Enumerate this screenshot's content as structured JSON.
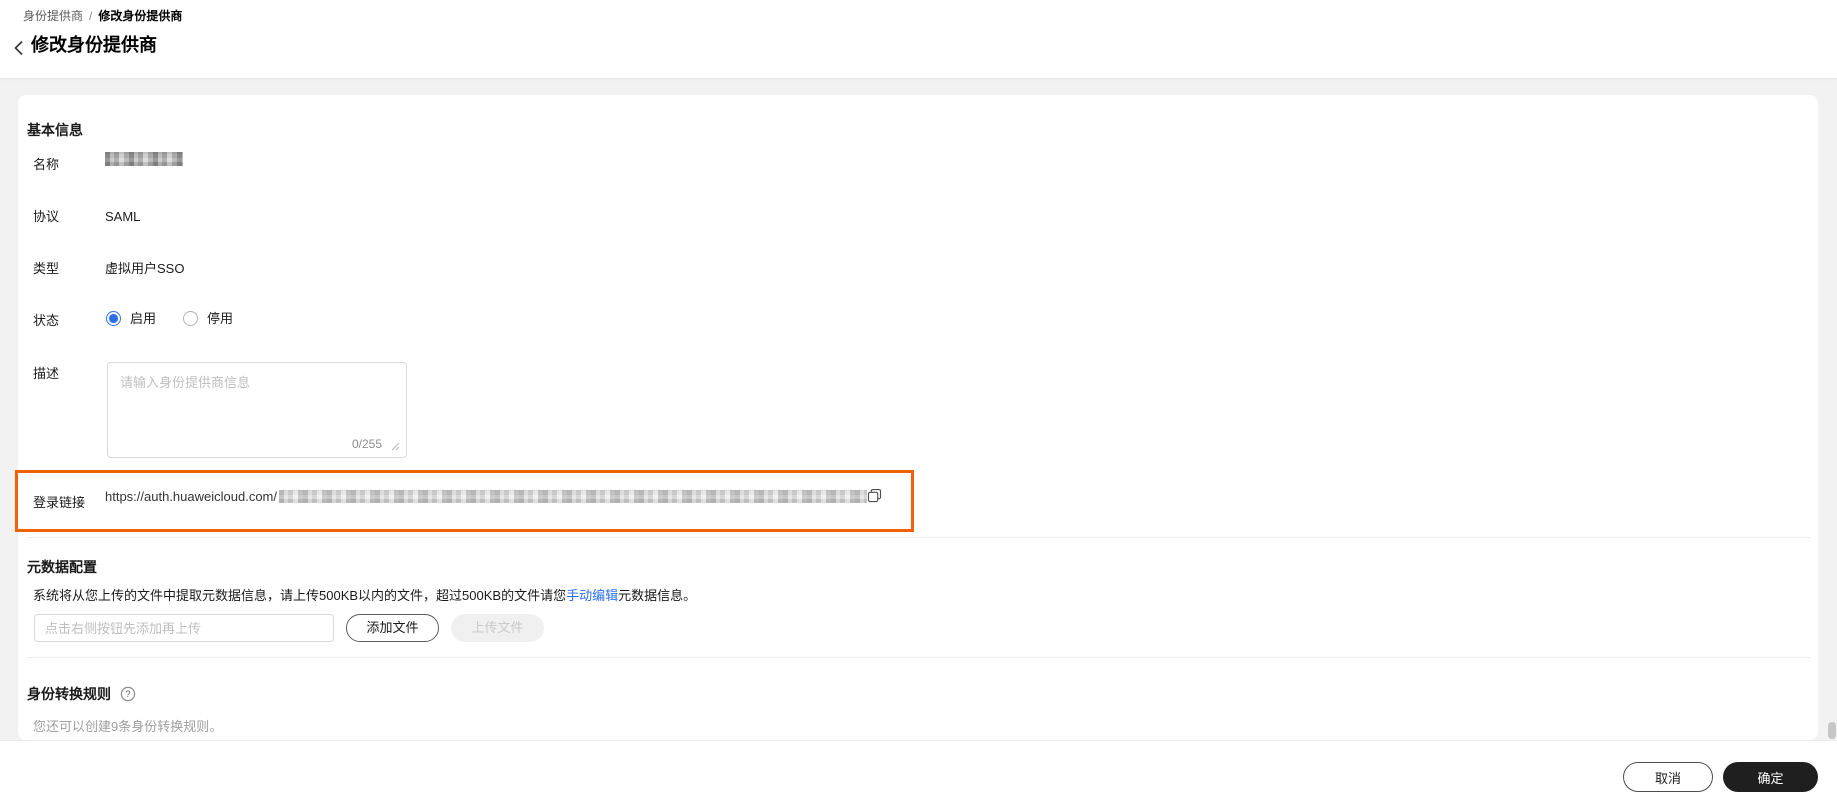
{
  "breadcrumb": {
    "parent": "身份提供商",
    "separator": "/",
    "current": "修改身份提供商"
  },
  "page": {
    "title": "修改身份提供商"
  },
  "basic_info": {
    "heading": "基本信息",
    "name": {
      "label": "名称",
      "value_redacted": true
    },
    "protocol": {
      "label": "协议",
      "value": "SAML"
    },
    "type": {
      "label": "类型",
      "value": "虚拟用户SSO"
    },
    "status": {
      "label": "状态",
      "options": [
        {
          "label": "启用",
          "selected": true
        },
        {
          "label": "停用",
          "selected": false
        }
      ]
    },
    "description": {
      "label": "描述",
      "placeholder": "请输入身份提供商信息",
      "value": "",
      "counter": "0/255"
    },
    "login_link": {
      "label": "登录链接",
      "url_visible_prefix": "https://auth.huaweicloud.com/",
      "url_rest_redacted": true,
      "highlighted": true,
      "highlight_color": "#F26007"
    }
  },
  "metadata_config": {
    "heading": "元数据配置",
    "description": {
      "prefix": "系统将从您上传的文件中提取元数据信息，请上传500KB以内的文件，超过500KB的文件请您",
      "link": "手动编辑",
      "suffix": "元数据信息。"
    },
    "file_input": {
      "placeholder": "点击右侧按钮先添加再上传",
      "value": ""
    },
    "add_file_button": "添加文件",
    "upload_file_button": "上传文件",
    "upload_file_disabled": true
  },
  "identity_rules": {
    "heading": "身份转换规则",
    "hint": "您还可以创建9条身份转换规则。"
  },
  "footer": {
    "cancel_label": "取消",
    "confirm_label": "确定"
  },
  "colors": {
    "accent_blue": "#2B6EF5",
    "highlight_orange": "#F26007",
    "primary_button_bg": "#1F1F1F",
    "page_bg": "#F2F2F2"
  }
}
